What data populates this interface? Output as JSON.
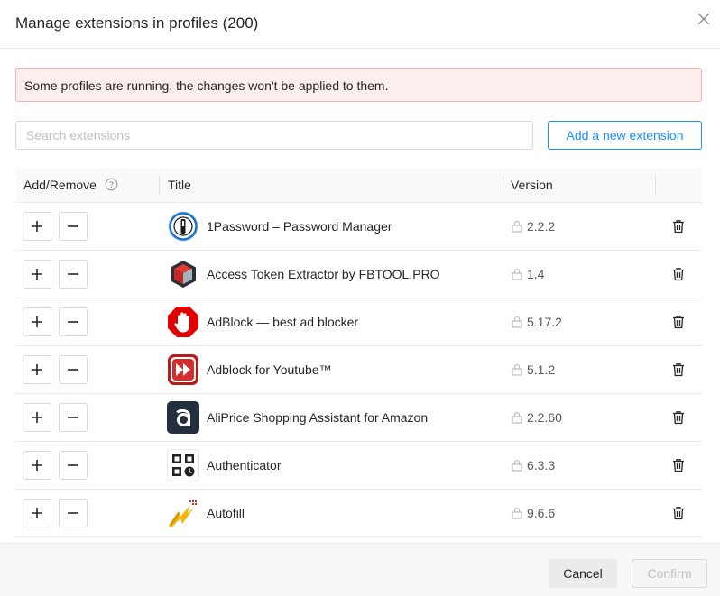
{
  "dialog": {
    "title": "Manage extensions in profiles (200)"
  },
  "alert": {
    "text": "Some profiles are running, the changes won't be applied to them."
  },
  "search": {
    "placeholder": "Search extensions",
    "value": ""
  },
  "add_extension_label": "Add a new extension",
  "table": {
    "headers": {
      "add_remove": "Add/Remove",
      "title": "Title",
      "version": "Version"
    },
    "rows": [
      {
        "title": "1Password – Password Manager",
        "version": "2.2.2",
        "icon": "1password-icon"
      },
      {
        "title": "Access Token Extractor by FBTOOL.PRO",
        "version": "1.4",
        "icon": "cube-icon"
      },
      {
        "title": "AdBlock — best ad blocker",
        "version": "5.17.2",
        "icon": "adblock-hand-icon"
      },
      {
        "title": "Adblock for Youtube™",
        "version": "5.1.2",
        "icon": "fast-forward-icon"
      },
      {
        "title": "AliPrice Shopping Assistant for Amazon",
        "version": "2.2.60",
        "icon": "aliprice-icon"
      },
      {
        "title": "Authenticator",
        "version": "6.3.3",
        "icon": "qr-code-icon"
      },
      {
        "title": "Autofill",
        "version": "9.6.6",
        "icon": "lightning-icon"
      }
    ]
  },
  "footer": {
    "cancel_label": "Cancel",
    "confirm_label": "Confirm"
  },
  "colors": {
    "accent": "#1890ff",
    "alert_bg": "#fdeeee",
    "alert_border": "#f5b3ae"
  }
}
